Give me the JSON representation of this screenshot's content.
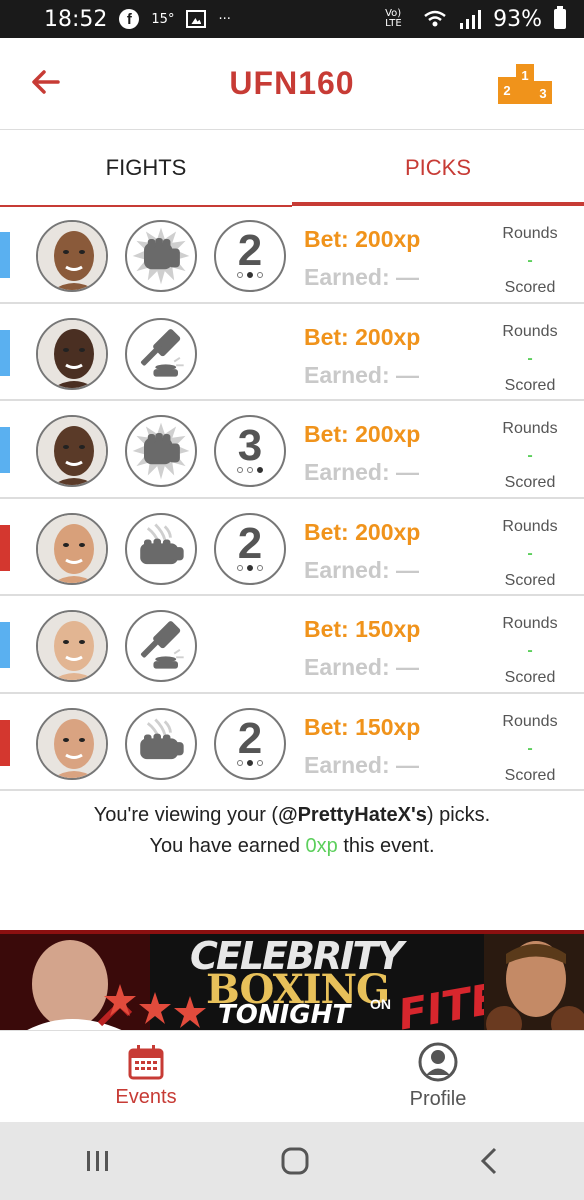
{
  "status_bar": {
    "time": "18:52",
    "temp": "15°",
    "more": "···",
    "network": "Vo) LTE",
    "battery_pct": "93%"
  },
  "header": {
    "title": "UFN160",
    "podium_labels": [
      "1",
      "2",
      "3"
    ]
  },
  "tabs": [
    {
      "label": "FIGHTS",
      "active": false
    },
    {
      "label": "PICKS",
      "active": true
    }
  ],
  "picks": [
    {
      "corner_color": "#5ab0f0",
      "method": "punch-icon",
      "round": "2",
      "round_dots": [
        false,
        true,
        false
      ],
      "bet": "Bet: 200xp",
      "earned": "Earned: —",
      "rounds_label": "Rounds",
      "rounds_value": "-",
      "scored_label": "Scored",
      "skin": "#8a5a3a"
    },
    {
      "corner_color": "#5ab0f0",
      "method": "gavel-icon",
      "round": "",
      "round_dots": [],
      "bet": "Bet: 200xp",
      "earned": "Earned: —",
      "rounds_label": "Rounds",
      "rounds_value": "-",
      "scored_label": "Scored",
      "skin": "#4a2f22"
    },
    {
      "corner_color": "#5ab0f0",
      "method": "punch-icon",
      "round": "3",
      "round_dots": [
        false,
        false,
        true
      ],
      "bet": "Bet: 200xp",
      "earned": "Earned: —",
      "rounds_label": "Rounds",
      "rounds_value": "-",
      "scored_label": "Scored",
      "skin": "#5a3a28"
    },
    {
      "corner_color": "#d4372f",
      "method": "submission-icon",
      "round": "2",
      "round_dots": [
        false,
        true,
        false
      ],
      "bet": "Bet: 200xp",
      "earned": "Earned: —",
      "rounds_label": "Rounds",
      "rounds_value": "-",
      "scored_label": "Scored",
      "skin": "#d8a07a"
    },
    {
      "corner_color": "#5ab0f0",
      "method": "gavel-icon",
      "round": "",
      "round_dots": [],
      "bet": "Bet: 150xp",
      "earned": "Earned: —",
      "rounds_label": "Rounds",
      "rounds_value": "-",
      "scored_label": "Scored",
      "skin": "#e2b592"
    },
    {
      "corner_color": "#d4372f",
      "method": "submission-icon",
      "round": "2",
      "round_dots": [
        false,
        true,
        false
      ],
      "bet": "Bet: 150xp",
      "earned": "Earned: —",
      "rounds_label": "Rounds",
      "rounds_value": "-",
      "scored_label": "Scored",
      "skin": "#d9a381"
    }
  ],
  "footer": {
    "line1_prefix": "You're viewing your (",
    "username": "@PrettyHateX's",
    "line1_suffix": ") picks.",
    "line2_prefix": "You have earned ",
    "earned_value": "0xp",
    "line2_suffix": " this event."
  },
  "banner": {
    "line1": "CELEBRITY",
    "line2": "BOXING",
    "line3": "TONIGHT",
    "on": "ON",
    "brand": "FITE"
  },
  "bottom_nav": [
    {
      "label": "Events",
      "icon": "calendar-icon",
      "active": true
    },
    {
      "label": "Profile",
      "icon": "person-icon",
      "active": false
    }
  ],
  "colors": {
    "accent": "#c73b35",
    "bet": "#f0931b",
    "earned": "#c9c9c9",
    "green": "#5ccf5c",
    "blue_corner": "#5ab0f0",
    "red_corner": "#d4372f"
  }
}
